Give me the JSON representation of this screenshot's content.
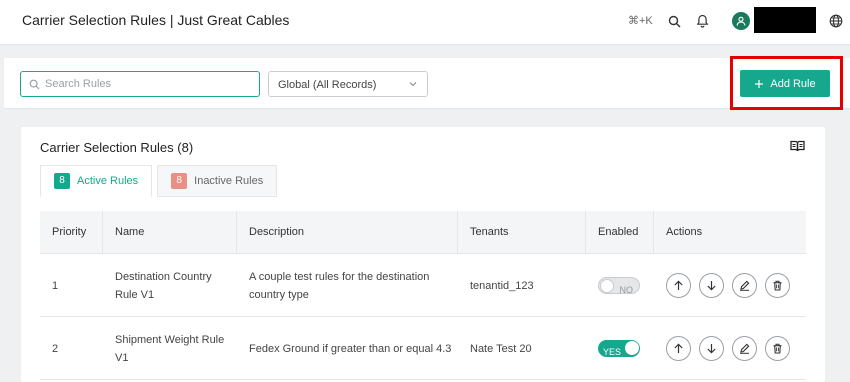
{
  "header": {
    "title": "Carrier Selection Rules | Just Great Cables",
    "shortcut": "⌘+K",
    "icons": [
      "search-icon",
      "bell-icon",
      "user-avatar-icon",
      "globe-icon"
    ]
  },
  "toolbar": {
    "search_placeholder": "Search Rules",
    "scope_select": "Global (All Records)",
    "add_button": "Add Rule"
  },
  "card": {
    "title": "Carrier Selection Rules (8)",
    "tabs": [
      {
        "label": "Active Rules",
        "count": "8"
      },
      {
        "label": "Inactive Rules",
        "count": "8"
      }
    ]
  },
  "table": {
    "columns": [
      "Priority",
      "Name",
      "Description",
      "Tenants",
      "Enabled",
      "Actions"
    ],
    "rows": [
      {
        "priority": "1",
        "name": "Destination Country Rule V1",
        "description": "A couple test rules for the destination country type",
        "tenants": "tenantid_123",
        "enabled": "NO"
      },
      {
        "priority": "2",
        "name": "Shipment Weight Rule V1",
        "description": "Fedex Ground if greater than or equal 4.3",
        "tenants": "Nate Test 20",
        "enabled": "YES"
      }
    ]
  },
  "colors": {
    "accent": "#16a88c",
    "highlight": "#e60000",
    "inactive_badge": "#e89086"
  }
}
